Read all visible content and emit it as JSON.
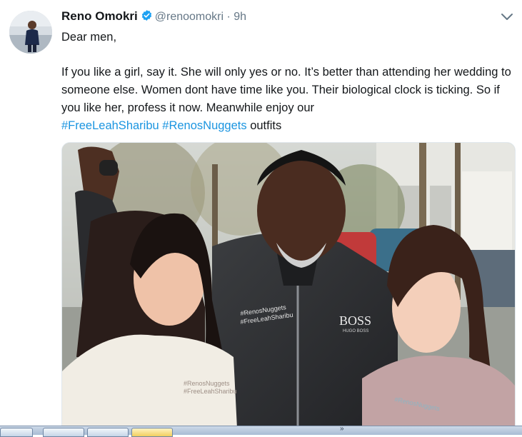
{
  "tweet": {
    "name": "Reno Omokri",
    "handle": "@renoomokri",
    "separator": "·",
    "time": "9h",
    "greeting": "Dear men,",
    "body": "If you like a girl, say it. She will only yes or no. It’s better than attending her wedding to someone else. Women dont have time like you. Their biological clock is ticking. So if you like her, profess it now. Meanwhile enjoy our ",
    "hashtags": [
      "#FreeLeahSharibu",
      "#RenosNuggets"
    ],
    "tail": " outfits",
    "sweatshirt_prints": {
      "center": [
        "#RenosNuggets",
        "#FreeLeahSharibu"
      ],
      "brand": "BOSS",
      "brand_sub": "HUGO BOSS",
      "left": [
        "#RenosNuggets",
        "#FreeLeahSharibu"
      ],
      "right": [
        "#RenosNuggets"
      ]
    }
  },
  "icons": {
    "verified": "verified-badge-icon",
    "menu": "chevron-down-icon"
  },
  "colors": {
    "link": "#1b95e0",
    "verified": "#1da1f2",
    "muted": "#657786",
    "text": "#14171a"
  }
}
